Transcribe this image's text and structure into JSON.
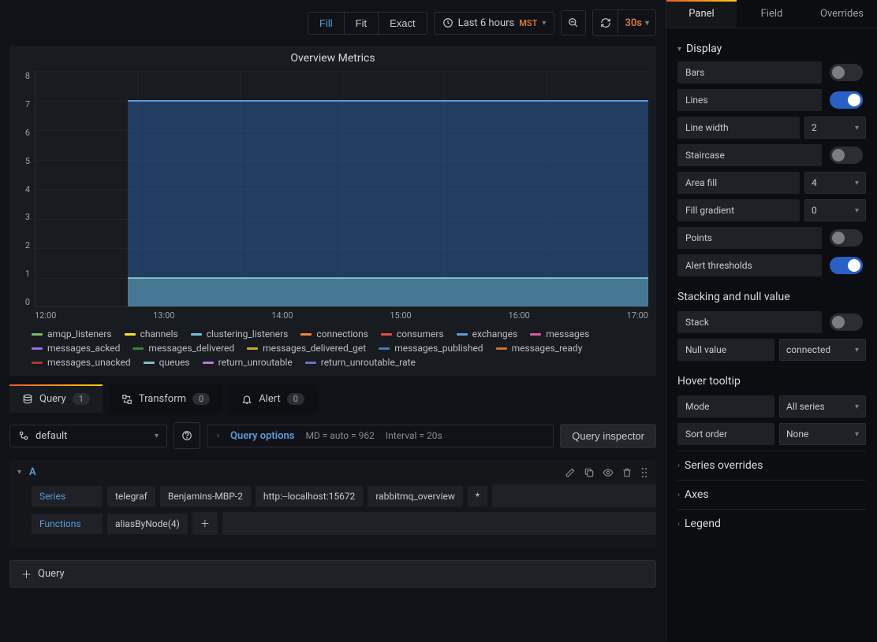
{
  "toolbar": {
    "scale_modes": [
      "Fill",
      "Fit",
      "Exact"
    ],
    "scale_active": "Fill",
    "time_range": "Last 6 hours",
    "time_tz": "MST",
    "refresh_interval": "30s"
  },
  "chart_data": {
    "type": "line",
    "title": "Overview Metrics",
    "ylim": [
      0,
      8
    ],
    "y_ticks": [
      8,
      7,
      6,
      5,
      4,
      3,
      2,
      1,
      0
    ],
    "x_ticks": [
      "12:00",
      "13:00",
      "14:00",
      "15:00",
      "16:00",
      "17:00"
    ],
    "series": [
      {
        "name": "amqp_listeners",
        "color": "#73bf69"
      },
      {
        "name": "channels",
        "color": "#fade2a"
      },
      {
        "name": "clustering_listeners",
        "color": "#6ec0e0"
      },
      {
        "name": "connections",
        "color": "#ef843c"
      },
      {
        "name": "consumers",
        "color": "#e24d42"
      },
      {
        "name": "exchanges",
        "color": "#5a9bdc",
        "value": 7
      },
      {
        "name": "messages",
        "color": "#d55aa2"
      },
      {
        "name": "messages_acked",
        "color": "#9b6edd"
      },
      {
        "name": "messages_delivered",
        "color": "#37872d"
      },
      {
        "name": "messages_delivered_get",
        "color": "#c7a82e"
      },
      {
        "name": "messages_published",
        "color": "#3d7cbf"
      },
      {
        "name": "messages_ready",
        "color": "#c4742a"
      },
      {
        "name": "messages_unacked",
        "color": "#b73131"
      },
      {
        "name": "queues",
        "color": "#7bbfc9",
        "value": 1
      },
      {
        "name": "return_unroutable",
        "color": "#b87bd6"
      },
      {
        "name": "return_unroutable_rate",
        "color": "#6b6fc9"
      }
    ]
  },
  "tabs": {
    "query": {
      "label": "Query",
      "count": "1"
    },
    "transform": {
      "label": "Transform",
      "count": "0"
    },
    "alert": {
      "label": "Alert",
      "count": "0"
    }
  },
  "datasource": {
    "selected": "default",
    "options_label": "Query options",
    "md": "MD = auto = 962",
    "interval": "Interval = 20s",
    "inspector": "Query inspector"
  },
  "query_a": {
    "ref": "A",
    "series_label": "Series",
    "series_parts": [
      "telegraf",
      "Benjamins-MBP-2",
      "http:--localhost:15672",
      "rabbitmq_overview",
      "*"
    ],
    "functions_label": "Functions",
    "functions": [
      "aliasByNode(4)"
    ]
  },
  "add_query": "Query",
  "side": {
    "tabs": [
      "Panel",
      "Field",
      "Overrides"
    ],
    "active": "Panel",
    "display": {
      "title": "Display",
      "bars": "Bars",
      "lines": "Lines",
      "line_width": "Line width",
      "line_width_val": "2",
      "staircase": "Staircase",
      "area_fill": "Area fill",
      "area_fill_val": "4",
      "fill_gradient": "Fill gradient",
      "fill_gradient_val": "0",
      "points": "Points",
      "alert_thresholds": "Alert thresholds"
    },
    "stacking": {
      "title": "Stacking and null value",
      "stack": "Stack",
      "null_value": "Null value",
      "null_value_val": "connected"
    },
    "hover": {
      "title": "Hover tooltip",
      "mode": "Mode",
      "mode_val": "All series",
      "sort": "Sort order",
      "sort_val": "None"
    },
    "collapsed": [
      "Series overrides",
      "Axes",
      "Legend"
    ]
  }
}
